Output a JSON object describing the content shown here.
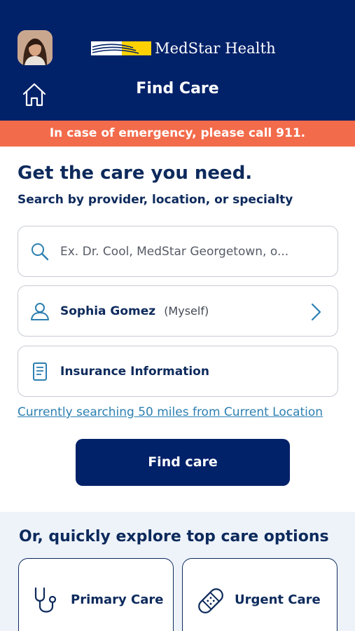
{
  "header": {
    "logo_text": "MedStar Health",
    "title": "Find Care",
    "home_icon": "home-icon",
    "colors": {
      "navy": "#012169",
      "logo_yellow": "#ffd100"
    }
  },
  "alert": {
    "text": "In case of emergency, please call 911.",
    "color": "#f26b4b"
  },
  "search_section": {
    "headline": "Get the care you need.",
    "subheadline": "Search by provider, location, or specialty",
    "search": {
      "placeholder": "Ex. Dr. Cool, MedStar Georgetown, o...",
      "icon": "search-icon"
    },
    "patient": {
      "name": "Sophia Gomez",
      "relation": "(Myself)",
      "icon": "person-icon",
      "chevron": "chevron-right-icon"
    },
    "insurance": {
      "label": "Insurance Information",
      "icon": "document-icon"
    },
    "radius_link": "Currently searching 50 miles from Current Location",
    "find_button": "Find care"
  },
  "explore": {
    "title": "Or, quickly explore top care options",
    "options": [
      {
        "label": "Primary Care",
        "icon": "stethoscope-icon"
      },
      {
        "label": "Urgent Care",
        "icon": "bandage-icon"
      }
    ]
  }
}
